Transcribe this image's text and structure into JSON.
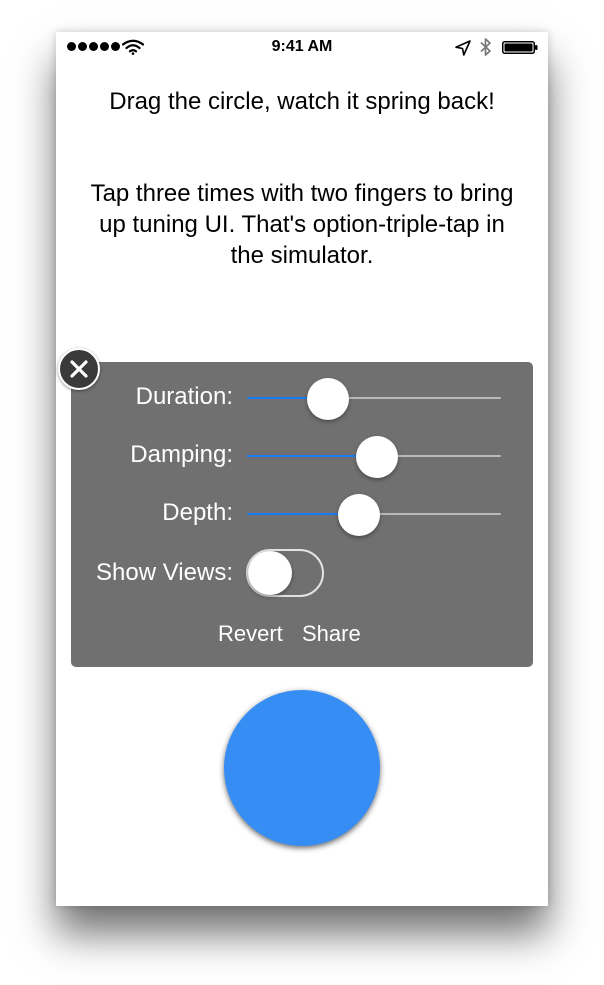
{
  "status_bar": {
    "time": "9:41 AM",
    "icons": [
      "signal-dots-icon",
      "wifi-icon",
      "location-arrow-icon",
      "bluetooth-icon",
      "battery-icon"
    ]
  },
  "instructions": {
    "line1": "Drag the circle, watch it spring back!",
    "line2": "Tap three times with two fingers to bring up tuning UI. That's option-triple-tap in the simulator."
  },
  "tuning_panel": {
    "close_icon": "close-x-icon",
    "sliders": [
      {
        "label": "Duration:",
        "value": 0.32
      },
      {
        "label": "Damping:",
        "value": 0.51
      },
      {
        "label": "Depth:",
        "value": 0.44
      }
    ],
    "toggle": {
      "label": "Show Views:",
      "on": false
    },
    "revert_label": "Revert",
    "share_label": "Share"
  },
  "colors": {
    "panel_bg": "#707070",
    "slider_fill": "#1a7bf2",
    "circle": "#368ef5"
  }
}
